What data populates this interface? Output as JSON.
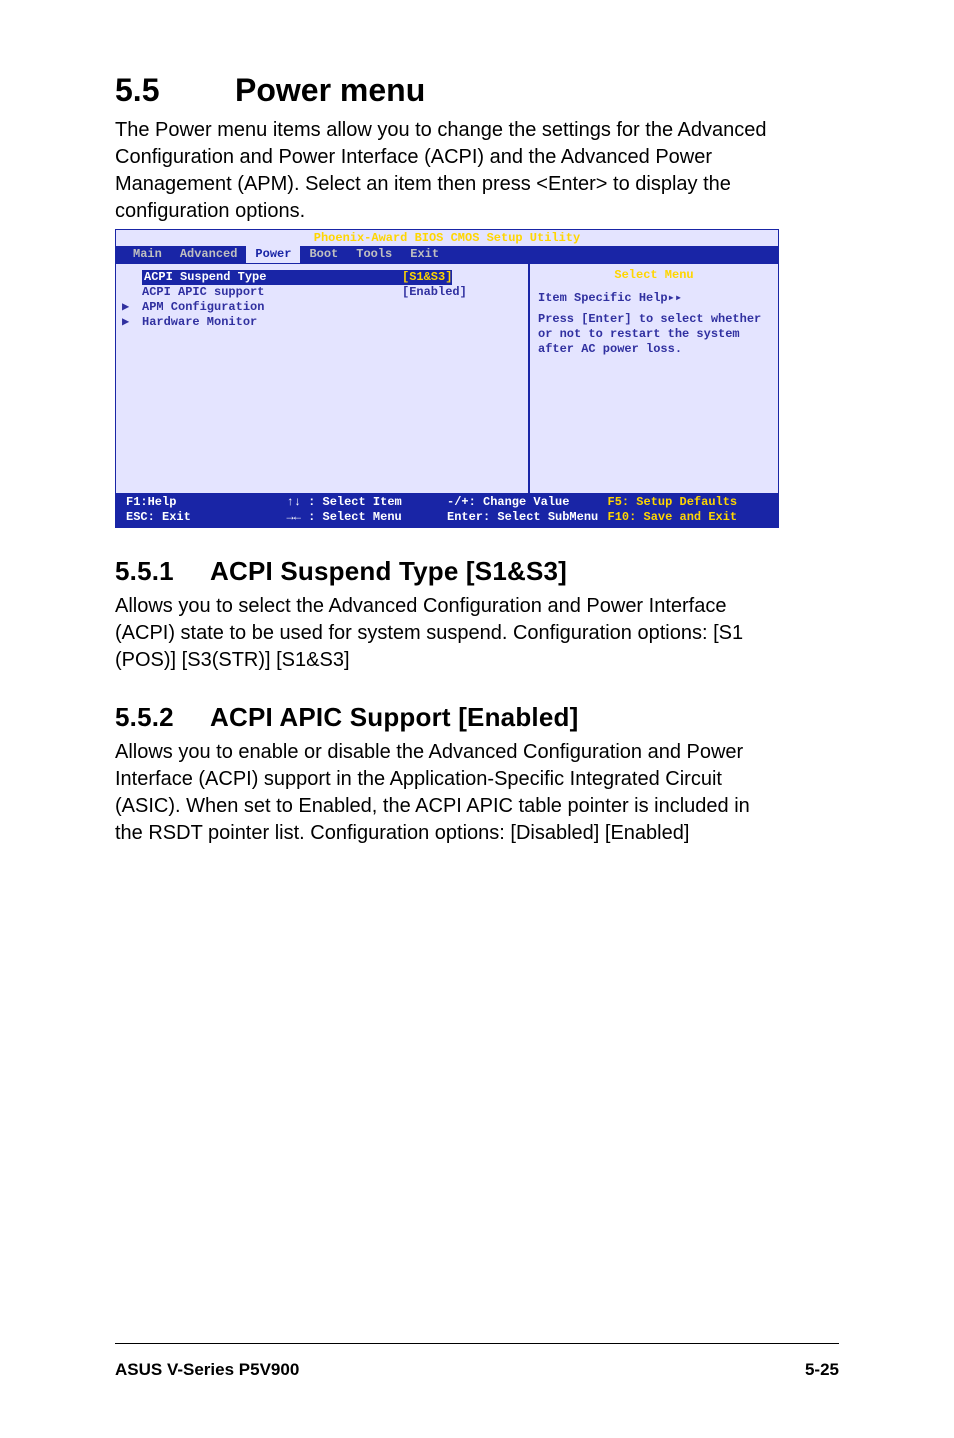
{
  "section": {
    "number": "5.5",
    "title": "Power menu",
    "desc": "The Power menu items allow you to change the settings for the Advanced Configuration and Power Interface (ACPI) and the Advanced Power Management (APM). Select an item then press <Enter> to display the configuration options."
  },
  "bios": {
    "title": "Phoenix-Award BIOS CMOS Setup Utility",
    "tabs": [
      "Main",
      "Advanced",
      "Power",
      "Boot",
      "Tools",
      "Exit"
    ],
    "active_tab": "Power",
    "items": [
      {
        "arrow": "",
        "label": "ACPI Suspend Type",
        "value": "[S1&S3]",
        "hl": true
      },
      {
        "arrow": "",
        "label": "ACPI APIC support",
        "value": "[Enabled]",
        "hl": false
      },
      {
        "arrow": "▶",
        "label": "APM Configuration",
        "value": "",
        "hl": false
      },
      {
        "arrow": "▶",
        "label": "Hardware Monitor",
        "value": "",
        "hl": false
      }
    ],
    "help_title": "Select Menu",
    "help_line1": "Item Specific Help▸▸",
    "help_body": "Press [Enter] to select whether or not to restart the system after AC power loss.",
    "footer": {
      "c1a": "F1:Help",
      "c1b": "ESC: Exit",
      "c2a": "↑↓ : Select Item",
      "c2b": "→← : Select Menu",
      "c3a": "-/+: Change Value",
      "c3b": "Enter: Select SubMenu",
      "c4a": "F5: Setup Defaults",
      "c4b": "F10: Save and Exit"
    }
  },
  "sub1": {
    "number": "5.5.1",
    "title": "ACPI Suspend Type [S1&S3]",
    "desc": "Allows you to select the Advanced Configuration and Power Interface (ACPI) state to be used for system suspend. Configuration options: [S1 (POS)] [S3(STR)] [S1&S3]"
  },
  "sub2": {
    "number": "5.5.2",
    "title": "ACPI APIC Support [Enabled]",
    "desc": "Allows you to enable or disable the Advanced Configuration and Power Interface (ACPI) support in the Application-Specific Integrated Circuit (ASIC). When set to Enabled, the ACPI APIC table pointer is included in the RSDT pointer list. Configuration options: [Disabled] [Enabled]"
  },
  "pagefoot": {
    "left": "ASUS V-Series P5V900",
    "right": "5-25"
  }
}
